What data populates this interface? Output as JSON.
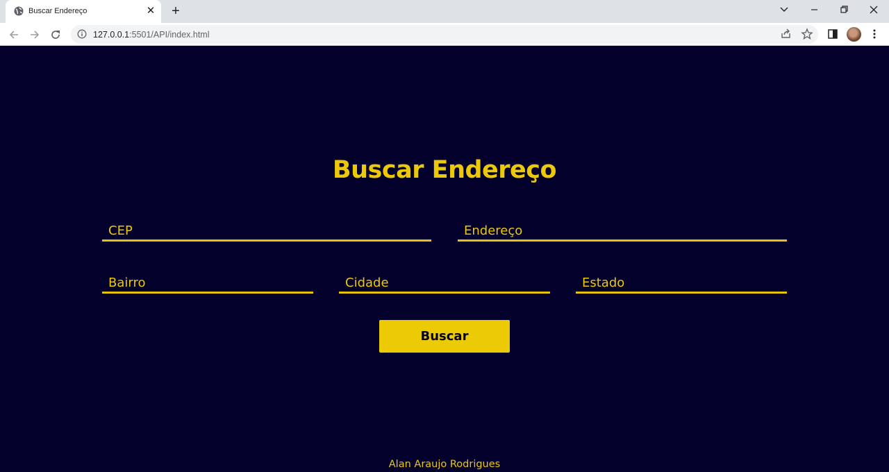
{
  "browser": {
    "tab_title": "Buscar Endereço",
    "url_host": "127.0.0.1",
    "url_path": ":5501/API/index.html"
  },
  "page": {
    "title": "Buscar Endereço",
    "fields": {
      "cep": "CEP",
      "endereco": "Endereço",
      "bairro": "Bairro",
      "cidade": "Cidade",
      "estado": "Estado"
    },
    "button_label": "Buscar",
    "footer": "Alan Araujo Rodrigues"
  },
  "colors": {
    "background": "#03002b",
    "accent": "#ecc80a"
  },
  "icons": [
    "globe-icon",
    "close-icon",
    "plus-icon",
    "chevron-down-icon",
    "minimize-icon",
    "restore-icon",
    "window-close-icon",
    "back-icon",
    "forward-icon",
    "reload-icon",
    "info-icon",
    "share-icon",
    "star-icon",
    "side-panel-icon",
    "avatar",
    "kebab-menu-icon"
  ]
}
